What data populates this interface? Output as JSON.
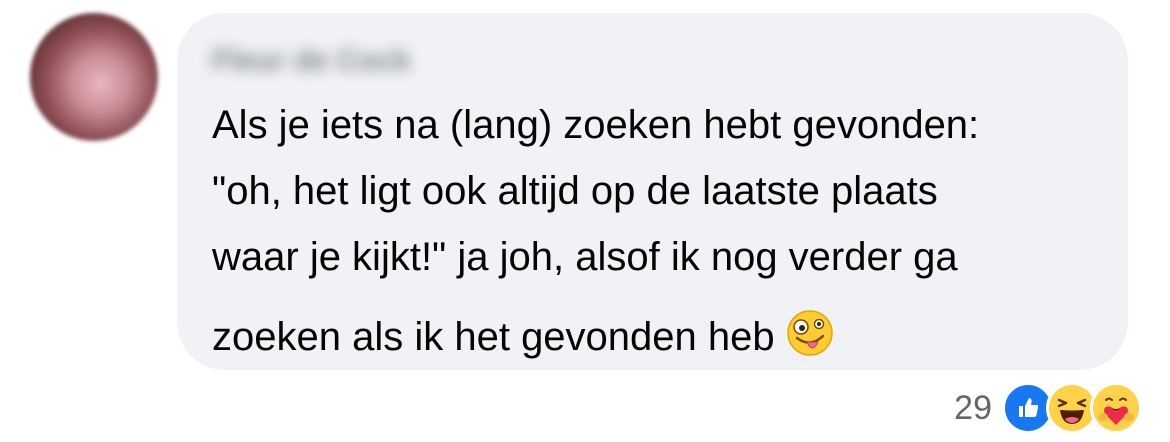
{
  "comment": {
    "author": "Fleur de Cock",
    "lines": [
      "Als je iets na (lang) zoeken hebt gevonden:",
      "\"oh, het ligt ook altijd op de laatste plaats",
      "waar je kijkt!\" ja joh, alsof ik nog verder ga",
      "zoeken als ik het gevonden heb"
    ],
    "trailing_emoji": "zany-face-icon"
  },
  "reactions": {
    "count": "29",
    "icons": [
      "like-icon",
      "haha-icon",
      "care-icon"
    ]
  },
  "colors": {
    "bubble": "#f0f2f5",
    "text": "#050505",
    "muted": "#65676b",
    "like_blue": "#1877f2"
  }
}
